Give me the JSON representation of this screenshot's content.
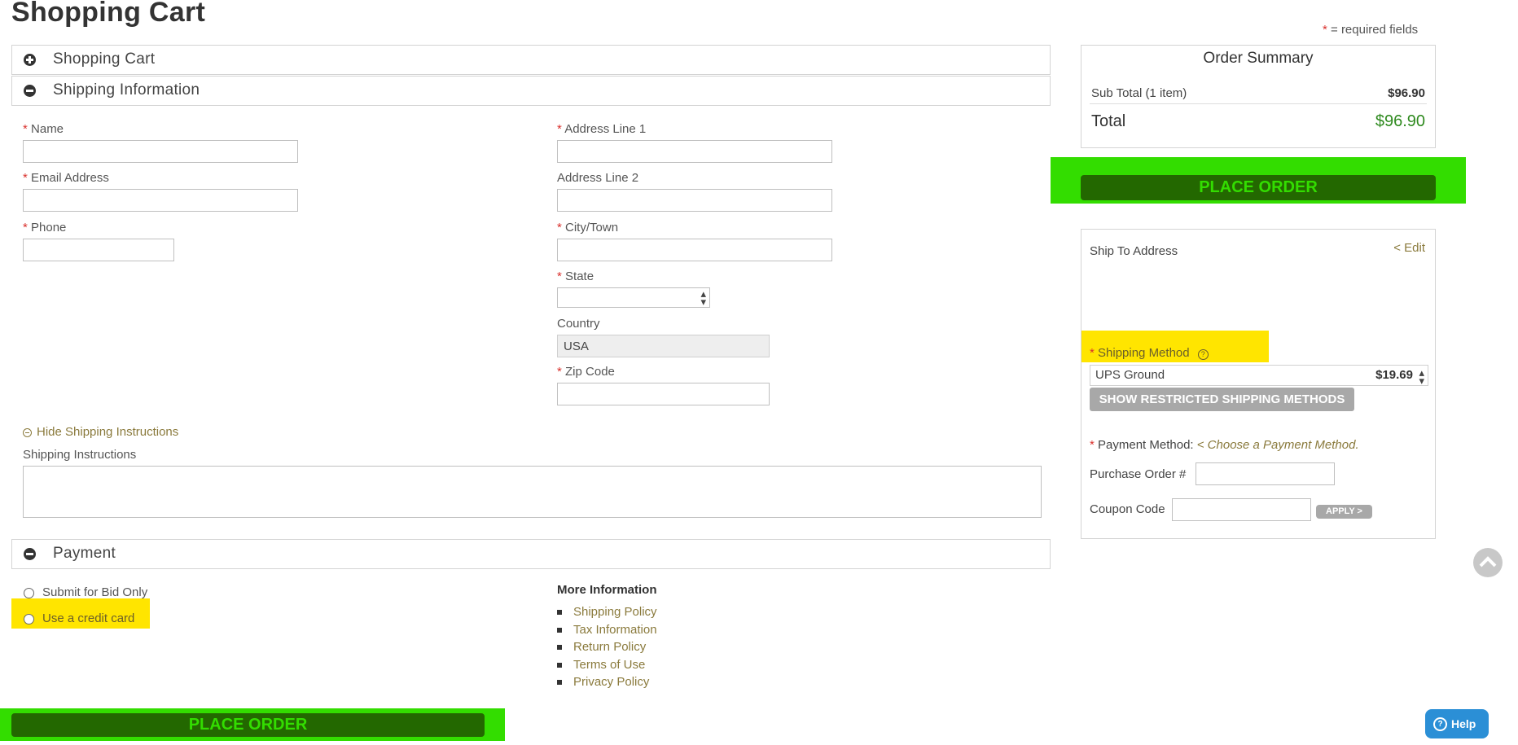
{
  "page": {
    "title": "Shopping Cart",
    "required_note_star": "*",
    "required_note": " = required fields"
  },
  "sections": {
    "cart": "Shopping Cart",
    "shipping": "Shipping Information",
    "payment": "Payment"
  },
  "shipping_form": {
    "name_label": "Name",
    "email_label": "Email Address",
    "phone_label": "Phone",
    "address1_label": "Address Line 1",
    "address2_label": "Address Line 2",
    "city_label": "City/Town",
    "state_label": "State",
    "country_label": "Country",
    "country_value": "USA",
    "zip_label": "Zip Code",
    "hide_instructions": "Hide Shipping Instructions",
    "instructions_label": "Shipping Instructions"
  },
  "payment": {
    "bid_option": "Submit for Bid Only",
    "credit_option": "Use a credit card"
  },
  "more_info": {
    "heading": "More Information",
    "links": [
      "Shipping Policy",
      "Tax Information",
      "Return Policy",
      "Terms of Use",
      "Privacy Policy"
    ]
  },
  "order_summary": {
    "heading": "Order Summary",
    "subtotal_label": "Sub Total (1 item)",
    "subtotal_value": "$96.90",
    "total_label": "Total",
    "total_value": "$96.90"
  },
  "place_order": "PLACE ORDER",
  "ship_panel": {
    "ship_to_label": "Ship To Address",
    "edit_link": "< Edit",
    "shipping_method_label": "Shipping Method",
    "shipping_method_value": "UPS Ground",
    "shipping_method_price": "$19.69",
    "restricted_button": "SHOW RESTRICTED SHIPPING METHODS",
    "payment_method_label": "Payment Method:",
    "payment_method_value": "< Choose a Payment Method.",
    "po_label": "Purchase Order #",
    "coupon_label": "Coupon Code",
    "apply_button": "APPLY >"
  },
  "help_button": "Help",
  "colors": {
    "highlight_green": "#33dd00",
    "button_dark_green": "#236800",
    "highlight_yellow": "#ffe500",
    "link_gold": "#8a7a3c",
    "total_green": "#2f8a1f",
    "help_blue": "#2b8fd6"
  }
}
